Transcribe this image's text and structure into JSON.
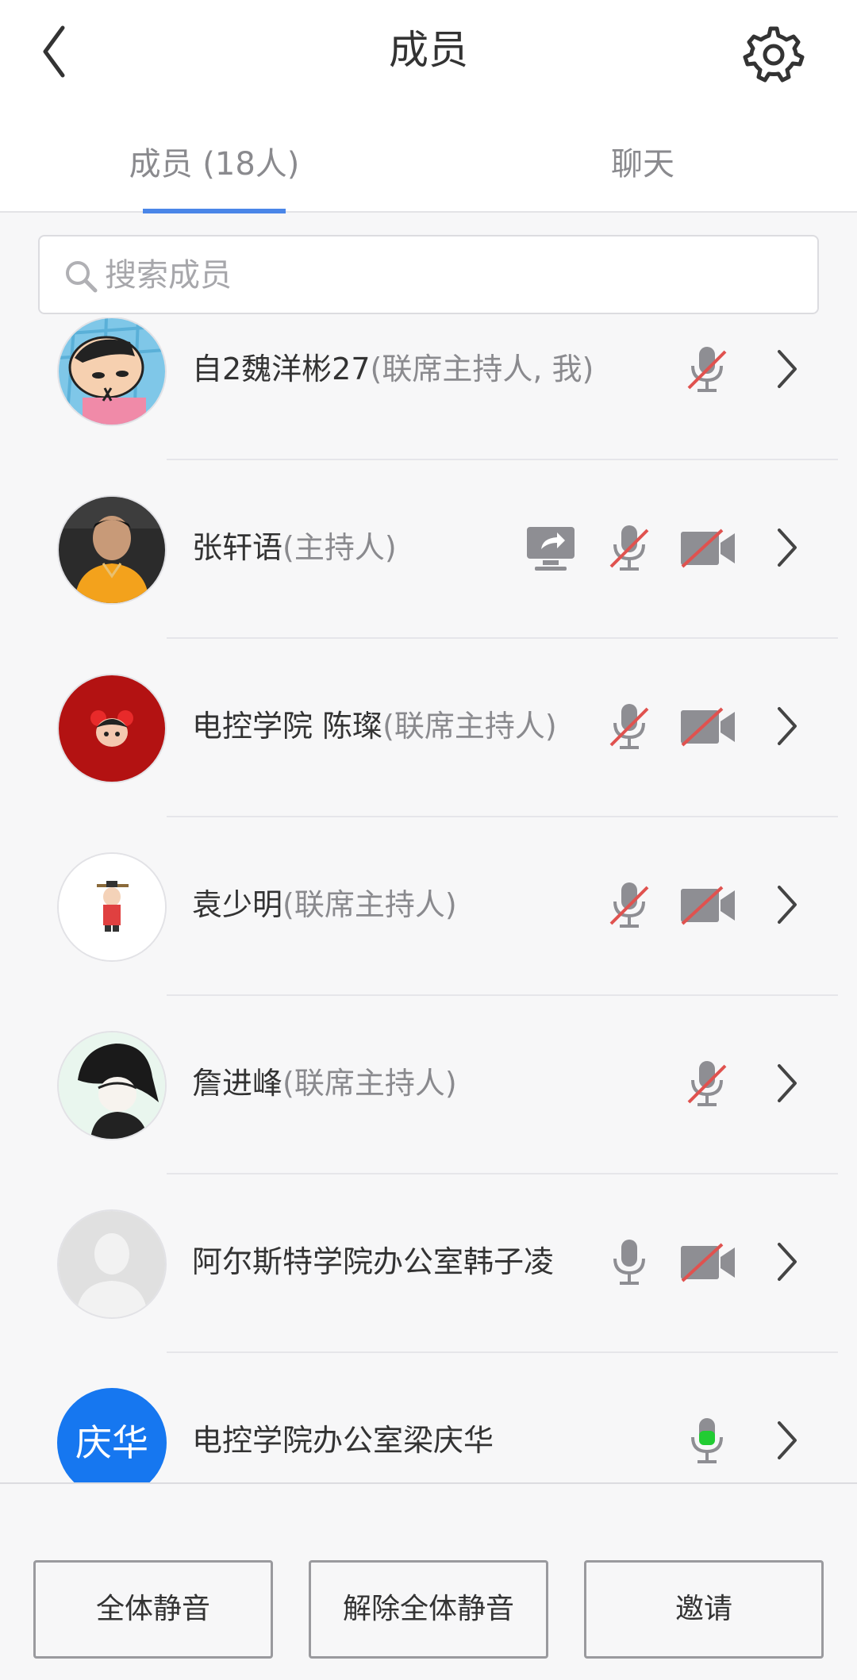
{
  "header": {
    "title": "成员",
    "back_icon": "chevron-left-icon",
    "settings_icon": "gear-icon"
  },
  "tabs": [
    {
      "label": "成员 (18人)",
      "active": true
    },
    {
      "label": "聊天",
      "active": false
    }
  ],
  "search": {
    "placeholder": "搜索成员",
    "value": ""
  },
  "members": [
    {
      "name": "自2魏洋彬27",
      "role": "(联席主持人, 我)",
      "avatar": "cartoon-avatar",
      "screen_share": false,
      "mic": "muted",
      "camera": "none"
    },
    {
      "name": "张轩语",
      "role": "(主持人)",
      "avatar": "photo-avatar",
      "screen_share": true,
      "mic": "muted",
      "camera": "off"
    },
    {
      "name": "电控学院 陈璨",
      "role": "(联席主持人)",
      "avatar": "red-cartoon-avatar",
      "screen_share": false,
      "mic": "muted",
      "camera": "off"
    },
    {
      "name": "袁少明",
      "role": "(联席主持人)",
      "avatar": "figure-avatar",
      "screen_share": false,
      "mic": "muted",
      "camera": "off"
    },
    {
      "name": "詹进峰",
      "role": "(联席主持人)",
      "avatar": "sketch-avatar",
      "screen_share": false,
      "mic": "muted",
      "camera": "none"
    },
    {
      "name": "阿尔斯特学院办公室韩子凌",
      "role": "",
      "avatar": "default-avatar",
      "screen_share": false,
      "mic": "on",
      "camera": "off"
    },
    {
      "name": "电控学院办公室梁庆华",
      "role": "",
      "avatar": "text-avatar",
      "avatar_text": "庆华",
      "screen_share": false,
      "mic": "speaking",
      "camera": "none"
    }
  ],
  "footer": {
    "mute_all": "全体静音",
    "unmute_all": "解除全体静音",
    "invite": "邀请"
  },
  "colors": {
    "accent": "#4a86e8",
    "muted_slash": "#e0524f",
    "speaking": "#22cc33",
    "icon_gray": "#8e8e93",
    "avatar_blue": "#1677f0"
  }
}
